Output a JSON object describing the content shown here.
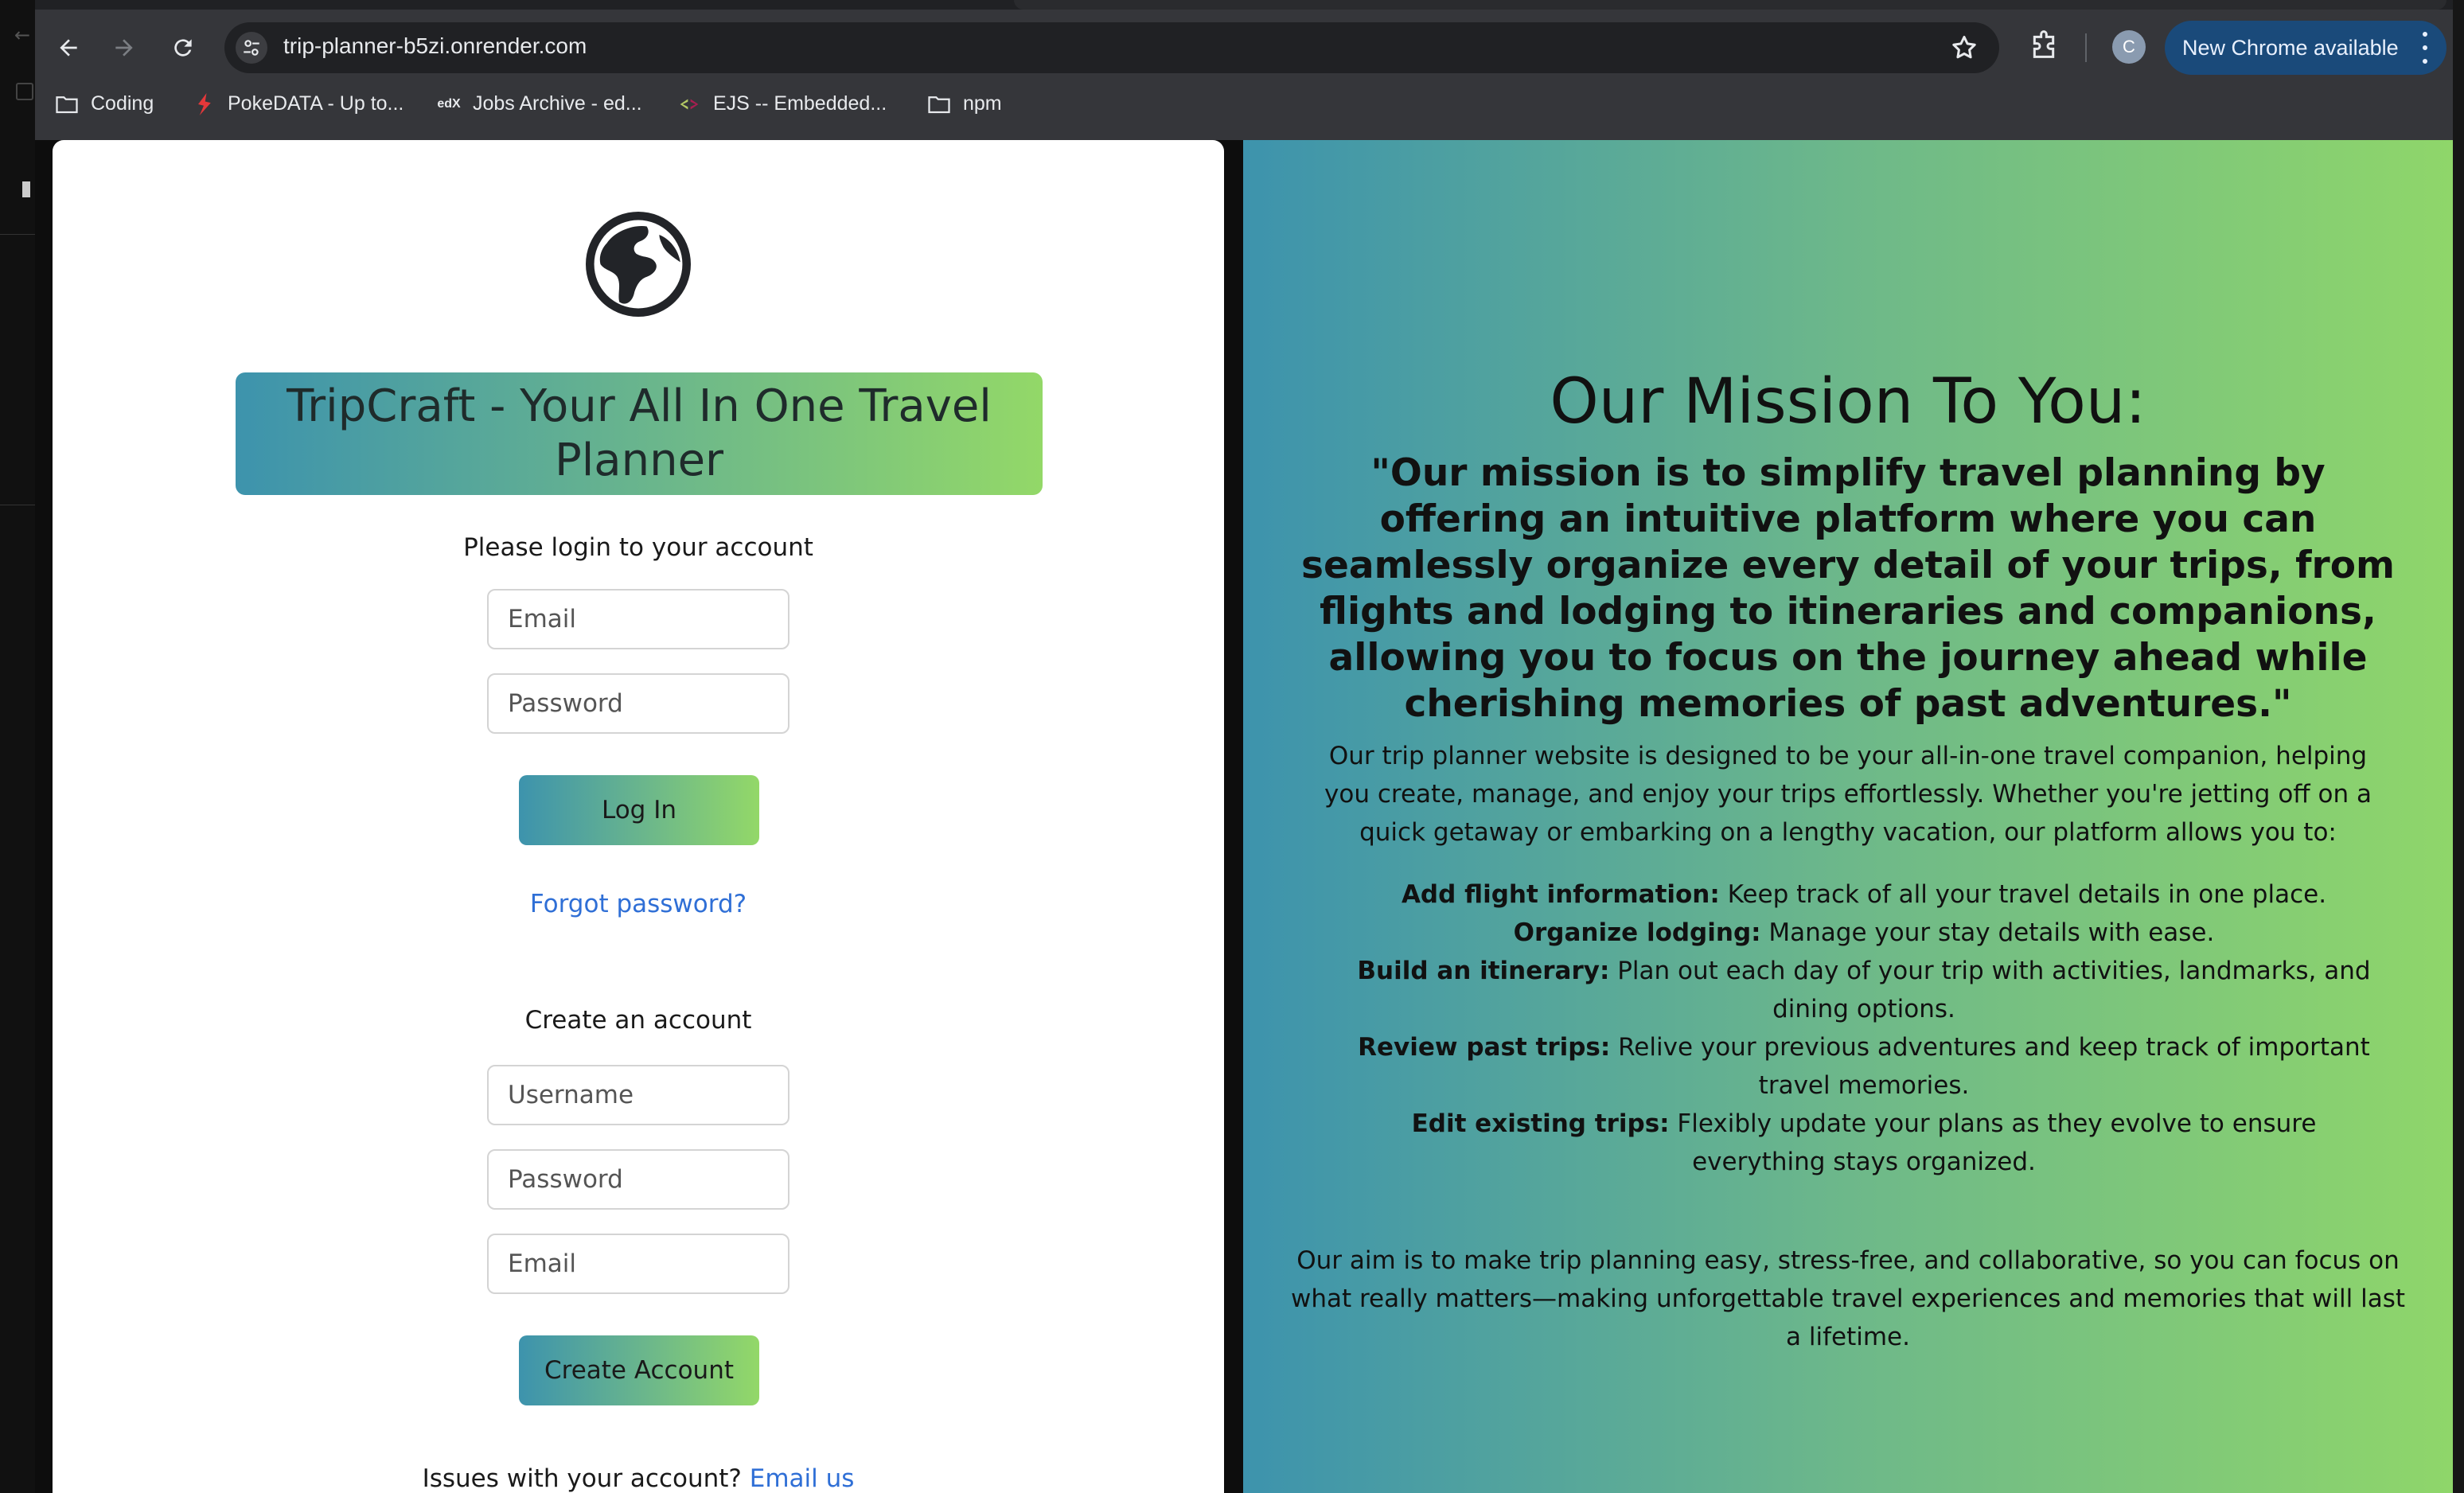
{
  "browser": {
    "url": "trip-planner-b5zi.onrender.com",
    "avatar_initial": "C",
    "update_button": "New Chrome available",
    "bookmarks": [
      {
        "label": "Coding",
        "icon": "folder-icon"
      },
      {
        "label": "PokeDATA - Up to...",
        "icon": "pokedata-favicon"
      },
      {
        "label": "Jobs Archive - ed...",
        "icon": "edx-favicon"
      },
      {
        "label": "EJS -- Embedded...",
        "icon": "ejs-favicon"
      },
      {
        "label": "npm",
        "icon": "folder-icon"
      }
    ]
  },
  "login": {
    "app_title": "TripCraft - Your All In One Travel Planner",
    "prompt": "Please login to your account",
    "email_placeholder": "Email",
    "password_placeholder": "Password",
    "login_button": "Log In",
    "forgot_link": "Forgot password?"
  },
  "signup": {
    "prompt": "Create an account",
    "username_placeholder": "Username",
    "password_placeholder": "Password",
    "email_placeholder": "Email",
    "create_button": "Create Account",
    "issues_text": "Issues with your account?",
    "email_link": "Email us"
  },
  "mission": {
    "title": "Our Mission To You:",
    "quote": "\"Our mission is to simplify travel planning by offering an intuitive platform where you can seamlessly organize every detail of your trips, from flights and lodging to itineraries and companions, allowing you to focus on the journey ahead while cherishing memories of past adventures.\"",
    "intro": "Our trip planner website is designed to be your all-in-one travel companion, helping you create, manage, and enjoy your trips effortlessly. Whether you're jetting off on a quick getaway or embarking on a lengthy vacation, our platform allows you to:",
    "features": [
      {
        "label": "Add flight information:",
        "text": "Keep track of all your travel details in one place."
      },
      {
        "label": "Organize lodging:",
        "text": "Manage your stay details with ease."
      },
      {
        "label": "Build an itinerary:",
        "text": "Plan out each day of your trip with activities, landmarks, and dining options."
      },
      {
        "label": "Review past trips:",
        "text": "Relive your previous adventures and keep track of important travel memories."
      },
      {
        "label": "Edit existing trips:",
        "text": "Flexibly update your plans as they evolve to ensure everything stays organized."
      }
    ],
    "aim": "Our aim is to make trip planning easy, stress-free, and collaborative, so you can focus on what really matters—making unforgettable travel experiences and memories that will last a lifetime."
  },
  "colors": {
    "gradient_start": "#3d93ad",
    "gradient_end": "#93d868",
    "link": "#2f6fd6"
  }
}
